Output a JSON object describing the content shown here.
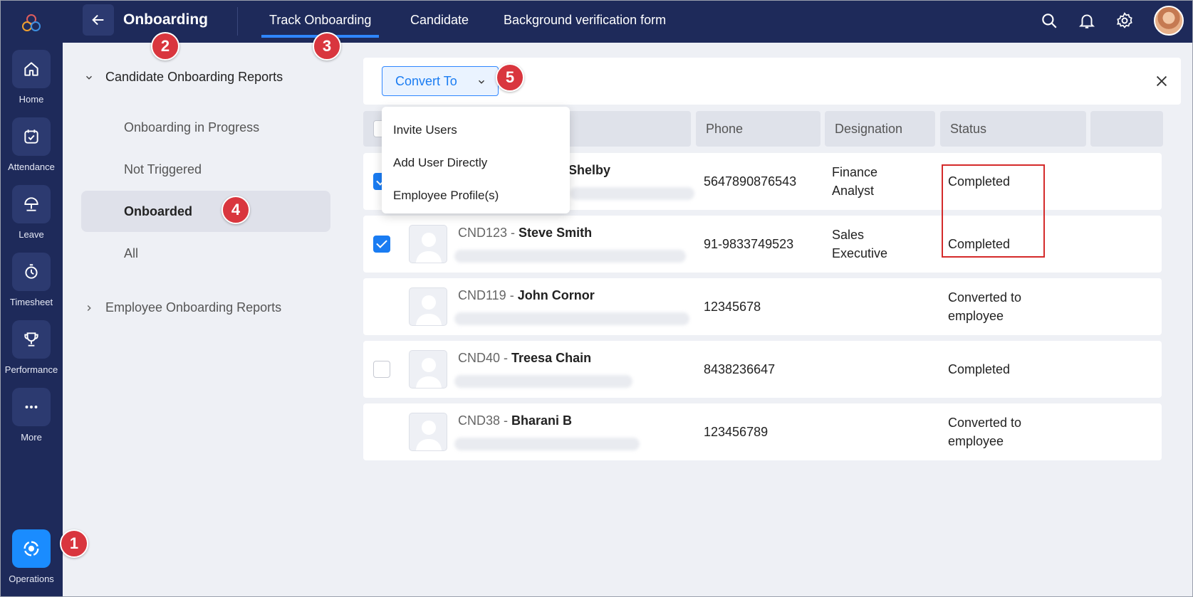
{
  "app": {
    "title": "Onboarding"
  },
  "tabs": [
    {
      "label": "Track Onboarding",
      "active": true
    },
    {
      "label": "Candidate",
      "active": false
    },
    {
      "label": "Background verification form",
      "active": false
    }
  ],
  "rail": {
    "items": [
      {
        "label": "Home",
        "icon": "home-icon"
      },
      {
        "label": "Attendance",
        "icon": "calendar-check-icon"
      },
      {
        "label": "Leave",
        "icon": "umbrella-icon"
      },
      {
        "label": "Timesheet",
        "icon": "stopwatch-icon"
      },
      {
        "label": "Performance",
        "icon": "trophy-icon"
      },
      {
        "label": "More",
        "icon": "more-icon"
      }
    ],
    "bottom": {
      "label": "Operations",
      "icon": "operations-icon",
      "active": true
    }
  },
  "reports": {
    "candidate_group": "Candidate Onboarding Reports",
    "items": [
      "Onboarding in Progress",
      "Not Triggered",
      "Onboarded",
      "All"
    ],
    "active_item": "Onboarded",
    "employee_group": "Employee Onboarding Reports"
  },
  "toolbar": {
    "convert_label": "Convert To"
  },
  "dropdown": {
    "items": [
      "Invite Users",
      "Add User Directly",
      "Employee Profile(s)"
    ]
  },
  "table": {
    "headers": [
      "Phone",
      "Designation",
      "Status"
    ],
    "rows": [
      {
        "id": "",
        "name": "Shelby",
        "phone": "5647890876543",
        "designation": [
          "Finance",
          "Analyst"
        ],
        "status": [
          "Completed"
        ],
        "checked": true
      },
      {
        "id": "CND123",
        "name": "Steve Smith",
        "phone": "91-9833749523",
        "designation": [
          "Sales",
          "Executive"
        ],
        "status": [
          "Completed"
        ],
        "checked": true
      },
      {
        "id": "CND119",
        "name": "John Cornor",
        "phone": "12345678",
        "designation": [],
        "status": [
          "Converted to",
          "employee"
        ],
        "checked": false,
        "checkbox": false
      },
      {
        "id": "CND40",
        "name": "Treesa Chain",
        "phone": "8438236647",
        "designation": [],
        "status": [
          "Completed"
        ],
        "checked": false,
        "checkbox": true
      },
      {
        "id": "CND38",
        "name": "Bharani B",
        "phone": "123456789",
        "designation": [],
        "status": [
          "Converted to",
          "employee"
        ],
        "checked": false,
        "checkbox": false
      }
    ],
    "separator": " - "
  },
  "callouts": [
    "1",
    "2",
    "3",
    "4",
    "5"
  ],
  "colors": {
    "navy": "#1e2a5a",
    "accent": "#1a7cf2",
    "callout": "#d9363e",
    "highlight": "#d42a2a"
  }
}
